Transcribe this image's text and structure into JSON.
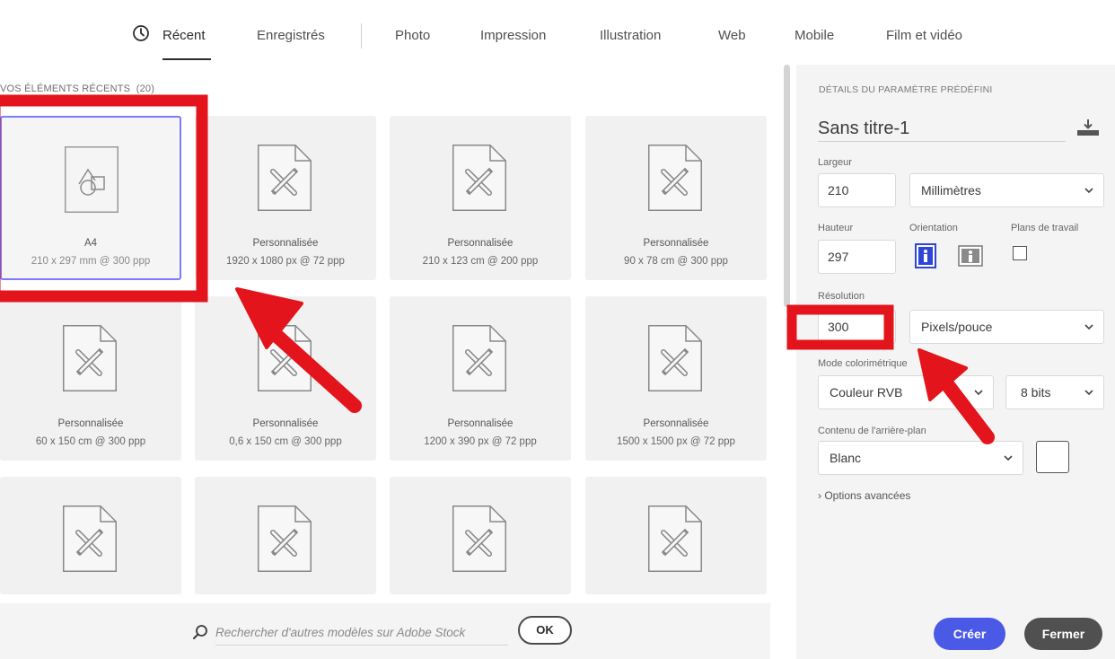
{
  "tabs": {
    "items": [
      {
        "label": "Récent"
      },
      {
        "label": "Enregistrés"
      },
      {
        "label": "Photo"
      },
      {
        "label": "Impression"
      },
      {
        "label": "Illustration"
      },
      {
        "label": "Web"
      },
      {
        "label": "Mobile"
      },
      {
        "label": "Film et vidéo"
      }
    ],
    "active": "Récent"
  },
  "recent": {
    "title": "VOS ÉLÉMENTS RÉCENTS",
    "count": "(20)",
    "items": [
      {
        "label": "A4",
        "sub": "210 x 297 mm @ 300 ppp",
        "icon": "document-shapes-icon",
        "selected": true
      },
      {
        "label": "Personnalisée",
        "sub": "1920 x 1080 px @ 72 ppp",
        "icon": "document-custom-icon"
      },
      {
        "label": "Personnalisée",
        "sub": "210 x 123 cm @ 200 ppp",
        "icon": "document-custom-icon"
      },
      {
        "label": "Personnalisée",
        "sub": "90 x 78 cm @ 300 ppp",
        "icon": "document-custom-icon"
      },
      {
        "label": "Personnalisée",
        "sub": "60 x 150 cm @ 300 ppp",
        "icon": "document-custom-icon"
      },
      {
        "label": "Personnalisée",
        "sub": "0,6 x 150 cm @ 300 ppp",
        "icon": "document-custom-icon"
      },
      {
        "label": "Personnalisée",
        "sub": "1200 x 390 px @ 72 ppp",
        "icon": "document-custom-icon"
      },
      {
        "label": "Personnalisée",
        "sub": "1500 x 1500 px @ 72 ppp",
        "icon": "document-custom-icon"
      },
      {
        "label": "",
        "sub": "",
        "icon": "document-custom-icon"
      },
      {
        "label": "",
        "sub": "",
        "icon": "document-custom-icon"
      },
      {
        "label": "",
        "sub": "",
        "icon": "document-custom-icon"
      },
      {
        "label": "",
        "sub": "",
        "icon": "document-custom-icon"
      }
    ]
  },
  "search": {
    "placeholder": "Rechercher d'autres modèles sur Adobe Stock",
    "ok_label": "OK"
  },
  "preset": {
    "section_title": "DÉTAILS DU PARAMÈTRE PRÉDÉFINI",
    "name": "Sans titre-1",
    "width_label": "Largeur",
    "width_value": "210",
    "width_unit": "Millimètres",
    "height_label": "Hauteur",
    "height_value": "297",
    "orientation_label": "Orientation",
    "artboards_label": "Plans de travail",
    "resolution_label": "Résolution",
    "resolution_value": "300",
    "resolution_unit": "Pixels/pouce",
    "color_mode_label": "Mode colorimétrique",
    "color_mode_value": "Couleur RVB",
    "bit_depth_value": "8 bits",
    "background_label": "Contenu de l'arrière-plan",
    "background_value": "Blanc",
    "advanced_label": "Options avancées",
    "create_label": "Créer",
    "close_label": "Fermer"
  },
  "colors": {
    "accent": "#4a59e6",
    "selected_border": "#7b7bff",
    "annotation_red": "#e3141b",
    "orientation_active": "#2e46d8"
  }
}
